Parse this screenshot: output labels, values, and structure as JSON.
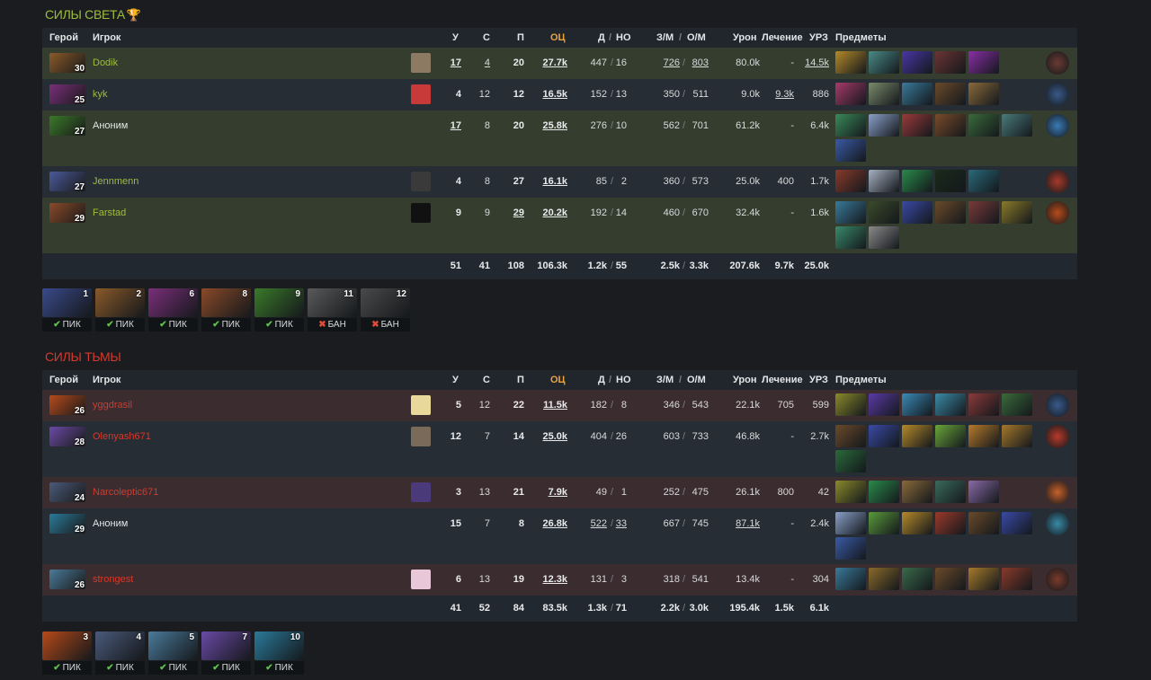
{
  "radiant": {
    "title": "СИЛЫ СВЕТА",
    "trophy_icon": "trophy-icon",
    "rows": [
      {
        "hero_color": "#8a5a2a",
        "level": "30",
        "player": "Dodik",
        "name_style": "r-name",
        "avatar_color": "#8c7a63",
        "kills": "17",
        "deaths": "4",
        "assists": "20",
        "networth": "27.7k",
        "lh": "447",
        "dn": "16",
        "gpm": "726",
        "xpm": "803",
        "damage": "80.0k",
        "heal": "-",
        "building": "14.5k",
        "items": [
          "#b58a2a",
          "#4a8a86",
          "#4a36a6",
          "#6c3434",
          "#8a2fa6"
        ],
        "neutral": "#6a3a32",
        "bg": "alt-r",
        "h": 35,
        "ul": {
          "kills": true,
          "deaths": true,
          "gpm": true,
          "xpm": true,
          "building": true
        }
      },
      {
        "hero_color": "#7a2f7a",
        "level": "25",
        "player": "kyk",
        "name_style": "r-name",
        "avatar_color": "#c83a3a",
        "kills": "4",
        "deaths": "12",
        "assists": "12",
        "networth": "16.5k",
        "lh": "152",
        "dn": "13",
        "gpm": "350",
        "xpm": "511",
        "damage": "9.0k",
        "heal": "9.3k",
        "building": "886",
        "items": [
          "#a63a6a",
          "#7a8a6a",
          "#3a7a9a",
          "#6a4a2a",
          "#8a6a3a"
        ],
        "neutral": "#3a5a8a",
        "bg": "plain",
        "h": 35,
        "ul": {
          "heal": true
        }
      },
      {
        "hero_color": "#3a7a2a",
        "level": "27",
        "player": "Аноним",
        "name_style": "anon",
        "avatar_color": "",
        "kills": "17",
        "deaths": "8",
        "assists": "20",
        "networth": "25.8k",
        "lh": "276",
        "dn": "10",
        "gpm": "562",
        "xpm": "701",
        "damage": "61.2k",
        "heal": "-",
        "building": "6.4k",
        "items": [
          "#3a8a5a",
          "#8aa0c8",
          "#9a3a3a",
          "#7a4a2a",
          "#3a6a3a",
          "#4a7a7a",
          "#3a5aa6"
        ],
        "neutral": "#3a7ab6",
        "bg": "alt-r",
        "h": 62,
        "ul": {
          "kills": true
        }
      },
      {
        "hero_color": "#4a5a9a",
        "level": "27",
        "player": "Jennmenn",
        "name_style": "r-name",
        "avatar_color": "#3a3a3a",
        "kills": "4",
        "deaths": "8",
        "assists": "27",
        "networth": "16.1k",
        "lh": "85",
        "dn": "2",
        "gpm": "360",
        "xpm": "573",
        "damage": "25.0k",
        "heal": "400",
        "building": "1.7k",
        "items": [
          "#8a3a2a",
          "#a6b0c0",
          "#2a8a4a",
          "#1a2a1a",
          "#2a6a7a"
        ],
        "neutral": "#a63a2a",
        "bg": "plain",
        "h": 35,
        "ul": {}
      },
      {
        "hero_color": "#8a4a2a",
        "level": "29",
        "player": "Farstad",
        "name_style": "r-name",
        "avatar_color": "#111",
        "kills": "9",
        "deaths": "9",
        "assists": "29",
        "networth": "20.2k",
        "lh": "192",
        "dn": "14",
        "gpm": "460",
        "xpm": "670",
        "damage": "32.4k",
        "heal": "-",
        "building": "1.6k",
        "items": [
          "#3a7a9a",
          "#3a4a2a",
          "#3a4aa6",
          "#6a4a2a",
          "#7a3a3a",
          "#8a7a2a",
          "#3a8a6a",
          "#8a8a8a"
        ],
        "neutral": "#b64a1a",
        "bg": "alt-r",
        "h": 62,
        "ul": {
          "assists": true
        }
      }
    ],
    "totals": {
      "kills": "51",
      "deaths": "41",
      "assists": "108",
      "networth": "106.3k",
      "lh": "1.2k",
      "dn": "55",
      "gpm": "2.5k",
      "xpm": "3.3k",
      "damage": "207.6k",
      "heal": "9.7k",
      "building": "25.0k"
    },
    "picks": [
      {
        "n": "1",
        "tag": "ПИК",
        "ban": false,
        "color": "#3a4a8a"
      },
      {
        "n": "2",
        "tag": "ПИК",
        "ban": false,
        "color": "#8a5a2a"
      },
      {
        "n": "6",
        "tag": "ПИК",
        "ban": false,
        "color": "#7a2f7a"
      },
      {
        "n": "8",
        "tag": "ПИК",
        "ban": false,
        "color": "#8a4a2a"
      },
      {
        "n": "9",
        "tag": "ПИК",
        "ban": false,
        "color": "#3a7a2a"
      },
      {
        "n": "11",
        "tag": "БАН",
        "ban": true,
        "color": "#5a5a5a"
      },
      {
        "n": "12",
        "tag": "БАН",
        "ban": true,
        "color": "#4a4a4a"
      }
    ]
  },
  "dire": {
    "title": "СИЛЫ ТЬМЫ",
    "rows": [
      {
        "hero_color": "#b64a1a",
        "level": "26",
        "player": "yggdrasil",
        "name_style": "d-name",
        "avatar_color": "#e8d89a",
        "kills": "5",
        "deaths": "12",
        "assists": "22",
        "networth": "11.5k",
        "lh": "182",
        "dn": "8",
        "gpm": "346",
        "xpm": "543",
        "damage": "22.1k",
        "heal": "705",
        "building": "599",
        "items": [
          "#8a8a2a",
          "#5a3aa6",
          "#3a8ab6",
          "#3a8aa6",
          "#8a3a3a",
          "#3a6a3a"
        ],
        "neutral": "#3a5a8a",
        "bg": "alt-d",
        "h": 35,
        "ul": {}
      },
      {
        "hero_color": "#6a4aa6",
        "level": "28",
        "player": "Olenyash671",
        "name_style": "d-name",
        "avatar_color": "#7a6a5a",
        "kills": "12",
        "deaths": "7",
        "assists": "14",
        "networth": "25.0k",
        "lh": "404",
        "dn": "26",
        "gpm": "603",
        "xpm": "733",
        "damage": "46.8k",
        "heal": "-",
        "building": "2.7k",
        "items": [
          "#6a4a2a",
          "#3a4aa6",
          "#b68a2a",
          "#6aa63a",
          "#b67a2a",
          "#a6782a",
          "#2a6a3a"
        ],
        "neutral": "#b63a2a",
        "bg": "plain",
        "h": 62,
        "ul": {}
      },
      {
        "hero_color": "#4a5a7a",
        "level": "24",
        "player": "Narcoleptic671",
        "name_style": "d-name",
        "avatar_color": "#4a3a7a",
        "kills": "3",
        "deaths": "13",
        "assists": "21",
        "networth": "7.9k",
        "lh": "49",
        "dn": "1",
        "gpm": "252",
        "xpm": "475",
        "damage": "26.1k",
        "heal": "800",
        "building": "42",
        "items": [
          "#8a8a2a",
          "#2a8a4a",
          "#8a6a3a",
          "#3a6a5a",
          "#8a6aa6"
        ],
        "neutral": "#c6602a",
        "bg": "alt-d",
        "h": 35,
        "ul": {}
      },
      {
        "hero_color": "#2a7a9a",
        "level": "29",
        "player": "Аноним",
        "name_style": "anon",
        "avatar_color": "",
        "kills": "15",
        "deaths": "7",
        "assists": "8",
        "networth": "26.8k",
        "lh": "522",
        "dn": "33",
        "gpm": "667",
        "xpm": "745",
        "damage": "87.1k",
        "heal": "-",
        "building": "2.4k",
        "items": [
          "#8aa0c8",
          "#5a9a3a",
          "#b68a2a",
          "#9a3a2a",
          "#6a4a2a",
          "#3a4aa6",
          "#3a5aa6"
        ],
        "neutral": "#3a8aa6",
        "bg": "plain",
        "h": 62,
        "ul": {
          "lh": true,
          "dn": true,
          "damage": true
        }
      },
      {
        "hero_color": "#4a7a9a",
        "level": "26",
        "player": "strongest",
        "name_style": "d-name",
        "avatar_color": "#e8c8d8",
        "kills": "6",
        "deaths": "13",
        "assists": "19",
        "networth": "12.3k",
        "lh": "131",
        "dn": "3",
        "gpm": "318",
        "xpm": "541",
        "damage": "13.4k",
        "heal": "-",
        "building": "304",
        "items": [
          "#3a7a9a",
          "#8a6a2a",
          "#3a6a4a",
          "#6a4a2a",
          "#a67a2a",
          "#8a3a2a"
        ],
        "neutral": "#7a3a2a",
        "bg": "alt-d",
        "h": 35,
        "ul": {}
      }
    ],
    "totals": {
      "kills": "41",
      "deaths": "52",
      "assists": "84",
      "networth": "83.5k",
      "lh": "1.3k",
      "dn": "71",
      "gpm": "2.2k",
      "xpm": "3.0k",
      "damage": "195.4k",
      "heal": "1.5k",
      "building": "6.1k"
    },
    "picks": [
      {
        "n": "3",
        "tag": "ПИК",
        "ban": false,
        "color": "#b64a1a"
      },
      {
        "n": "4",
        "tag": "ПИК",
        "ban": false,
        "color": "#4a5a7a"
      },
      {
        "n": "5",
        "tag": "ПИК",
        "ban": false,
        "color": "#4a7a9a"
      },
      {
        "n": "7",
        "tag": "ПИК",
        "ban": false,
        "color": "#6a4aa6"
      },
      {
        "n": "10",
        "tag": "ПИК",
        "ban": false,
        "color": "#2a7a9a"
      }
    ]
  },
  "headers": {
    "hero": "Герой",
    "player": "Игрок",
    "kills": "У",
    "deaths": "С",
    "assists": "П",
    "networth": "ОЦ",
    "lh": "Д",
    "dn": "НО",
    "gpm": "З/М",
    "xpm": "О/М",
    "damage": "Урон",
    "heal": "Лечение",
    "building": "УРЗ",
    "items": "Предметы"
  },
  "colors": {
    "radiant": "#9dbe3b",
    "dire": "#d43a2d",
    "gold": "#e8a33d",
    "pick_ok": "#5cc04a",
    "ban": "#e04b3c"
  }
}
